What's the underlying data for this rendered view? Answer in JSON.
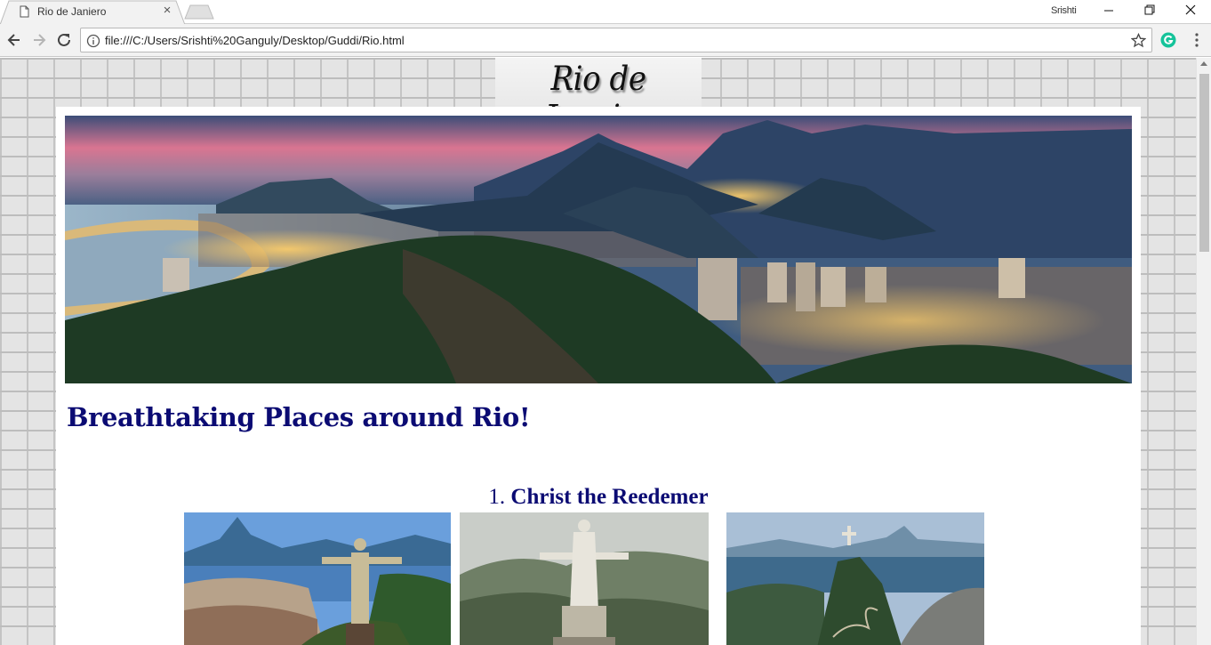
{
  "browser": {
    "tab_title": "Rio de Janiero",
    "tab_close": "×",
    "profile_name": "Srishti",
    "url": "file:///C:/Users/Srishti%20Ganguly/Desktop/Guddi/Rio.html"
  },
  "page": {
    "site_title": "Rio de Janeiro",
    "heading": "Breathtaking Places around Rio!",
    "item_number": "1.",
    "item_name": "Christ the Reedemer"
  },
  "colors": {
    "heading": "#0b0b73",
    "page_background": "#e4e4e4",
    "content_background": "#ffffff"
  },
  "icons": [
    "document-icon",
    "close-icon",
    "new-tab-icon",
    "minimize-icon",
    "maximize-icon",
    "close-window-icon",
    "back-arrow-icon",
    "forward-arrow-icon",
    "reload-icon",
    "info-icon",
    "star-icon",
    "grammarly-icon",
    "more-menu-icon"
  ]
}
